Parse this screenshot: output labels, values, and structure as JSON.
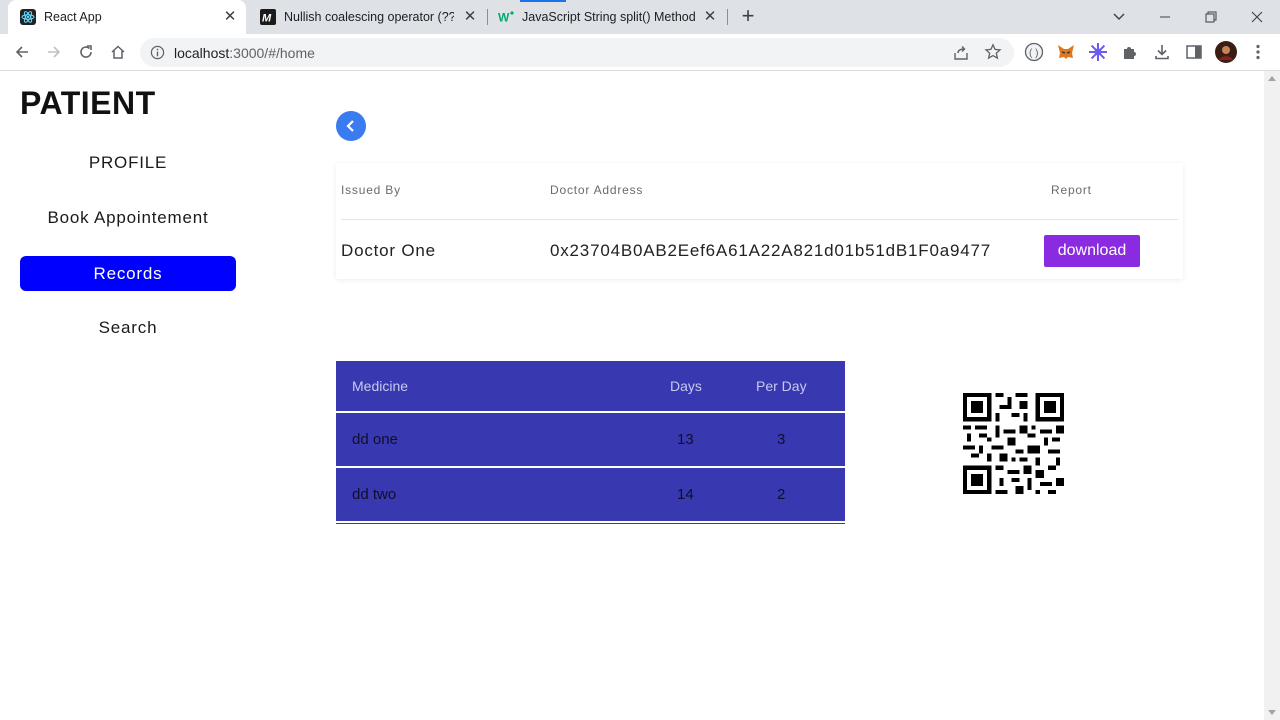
{
  "browser": {
    "tabs": [
      {
        "title": "React App",
        "favicon": "react-icon",
        "active": true
      },
      {
        "title": "Nullish coalescing operator (??) -",
        "favicon": "mdn-icon",
        "active": false
      },
      {
        "title": "JavaScript String split() Method",
        "favicon": "w3schools-icon",
        "active": false
      }
    ],
    "address": {
      "host": "localhost",
      "path": ":3000/#/home"
    }
  },
  "sidebar": {
    "brand": "PATIENT",
    "items": [
      {
        "label": "PROFILE",
        "active": false
      },
      {
        "label": "Book Appointement",
        "active": false
      },
      {
        "label": "Records",
        "active": true
      },
      {
        "label": "Search",
        "active": false
      }
    ],
    "active_color": "#0000ff"
  },
  "record": {
    "headers": {
      "issued_by": "Issued By",
      "doctor_address": "Doctor Address",
      "report": "Report"
    },
    "issued_by": "Doctor One",
    "doctor_address": "0x23704B0AB2Eef6A61A22A821d01b51dB1F0a9477",
    "download_label": "download",
    "download_color": "#8a2be2"
  },
  "medicines": {
    "headers": {
      "medicine": "Medicine",
      "days": "Days",
      "per_day": "Per Day"
    },
    "rows": [
      {
        "medicine": "dd one",
        "days": "13",
        "per_day": "3"
      },
      {
        "medicine": "dd two",
        "days": "14",
        "per_day": "2"
      }
    ],
    "background": "#3838b0"
  },
  "qr_code": "qr-code-icon"
}
